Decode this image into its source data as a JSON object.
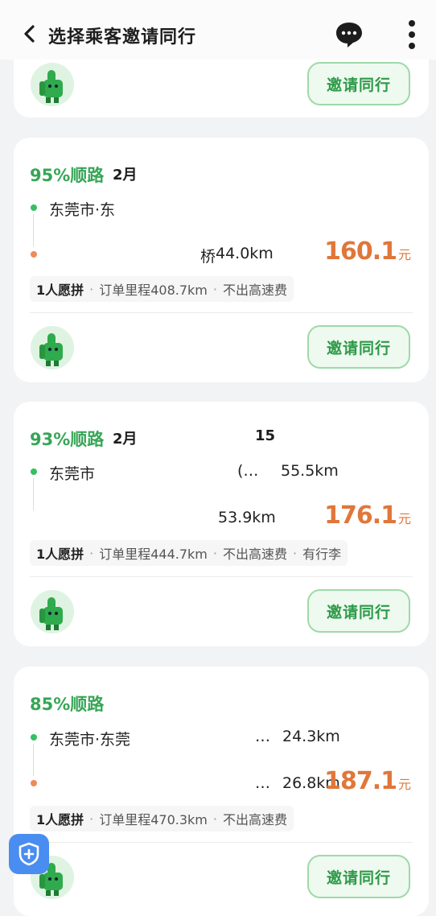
{
  "header": {
    "title": "选择乘客邀请同行",
    "back_icon": "chevron-left-icon",
    "message_icon": "chat-bubble-icon",
    "more_icon": "more-vertical-icon"
  },
  "invite_label": "邀请同行",
  "cards": [
    {},
    {
      "match": "95%顺路",
      "date": "2月",
      "start": "东莞市·东",
      "end_suffix": "桥",
      "end_distance": "44.0km",
      "price": "160.1",
      "unit": "元",
      "tags": [
        "1人愿拼",
        "订单里程408.7km",
        "不出高速费"
      ]
    },
    {
      "match": "93%顺路",
      "date": "2月",
      "date_tail": "15",
      "start": "东莞市",
      "start_mid": "(…",
      "start_distance": "55.5km",
      "end_distance": "53.9km",
      "price": "176.1",
      "unit": "元",
      "tags": [
        "1人愿拼",
        "订单里程444.7km",
        "不出高速费",
        "有行李"
      ]
    },
    {
      "match": "85%顺路",
      "start": "东莞市·东莞",
      "start_mid": "…",
      "start_distance": "24.3km",
      "end_mid": "…",
      "end_distance": "26.8km",
      "price": "187.1",
      "unit": "元",
      "tags": [
        "1人愿拼",
        "订单里程470.3km",
        "不出高速费"
      ]
    }
  ],
  "colors": {
    "accent_green": "#36a656",
    "price_orange": "#e0773a",
    "safety_blue": "#4a8df0"
  }
}
